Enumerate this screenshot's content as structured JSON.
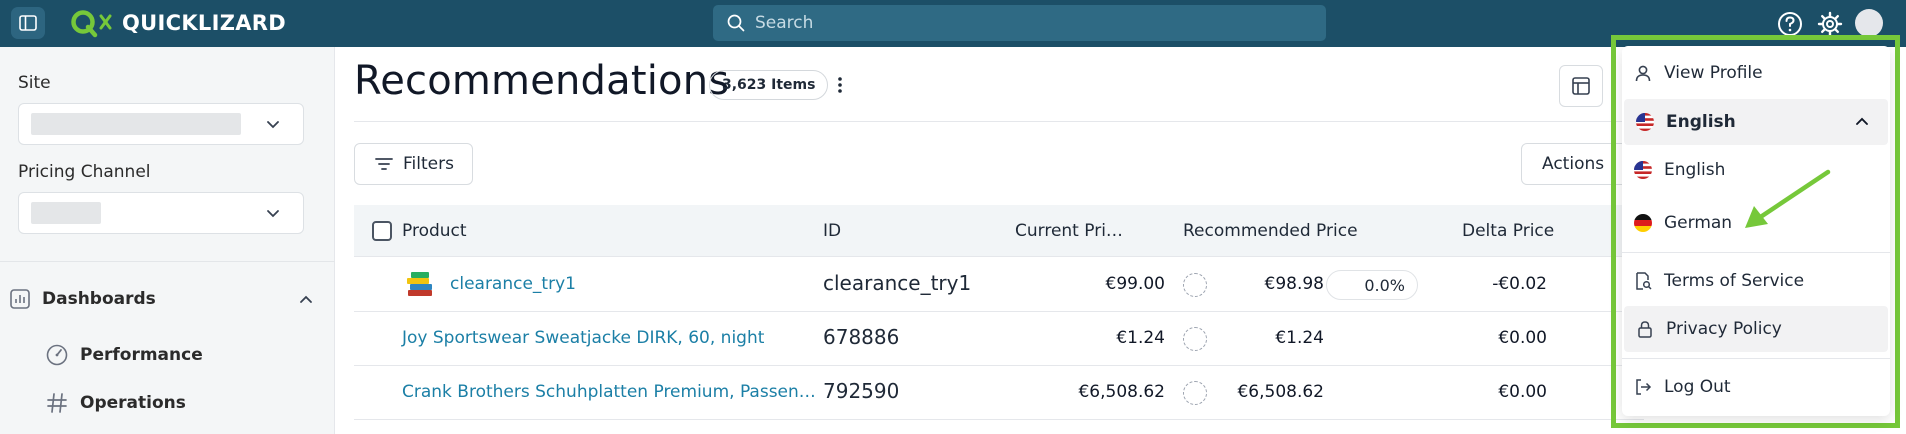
{
  "header": {
    "brand": "QUICKLIZARD",
    "search_placeholder": "Search",
    "icons": [
      "sidebar-toggle-icon",
      "help-icon",
      "gear-icon",
      "avatar"
    ]
  },
  "sidebar": {
    "site_label": "Site",
    "pricing_channel_label": "Pricing Channel",
    "dashboards_label": "Dashboards",
    "items": [
      {
        "label": "Performance",
        "icon": "gauge-icon"
      },
      {
        "label": "Operations",
        "icon": "hash-icon"
      }
    ]
  },
  "main": {
    "title": "Recommendations",
    "item_count": "3,623 Items",
    "filters_label": "Filters",
    "actions_label": "Actions"
  },
  "table": {
    "columns": [
      "Product",
      "ID",
      "Current Pri…",
      "Recommended Price",
      "Delta Price"
    ],
    "rows": [
      {
        "product": "clearance_try1",
        "id": "clearance_try1",
        "current_price": "€99.00",
        "recommended_price": "€98.98",
        "pct": "0.0%",
        "delta": "-€0.02"
      },
      {
        "product": "Joy Sportswear Sweatjacke DIRK, 60, night",
        "id": "678886",
        "current_price": "€1.24",
        "recommended_price": "€1.24",
        "delta": "€0.00"
      },
      {
        "product": "Crank Brothers Schuhplatten Premium, Passen…",
        "id": "792590",
        "current_price": "€6,508.62",
        "recommended_price": "€6,508.62",
        "delta": "€0.00"
      }
    ]
  },
  "menu": {
    "view_profile": "View Profile",
    "language_current": "English",
    "language_options": [
      "English",
      "German"
    ],
    "terms": "Terms of Service",
    "privacy": "Privacy Policy",
    "logout": "Log Out"
  },
  "colors": {
    "topbar": "#1c4f67",
    "brand_green": "#76c83a",
    "link": "#1b7fa6",
    "highlight_outline": "#76c83a"
  }
}
